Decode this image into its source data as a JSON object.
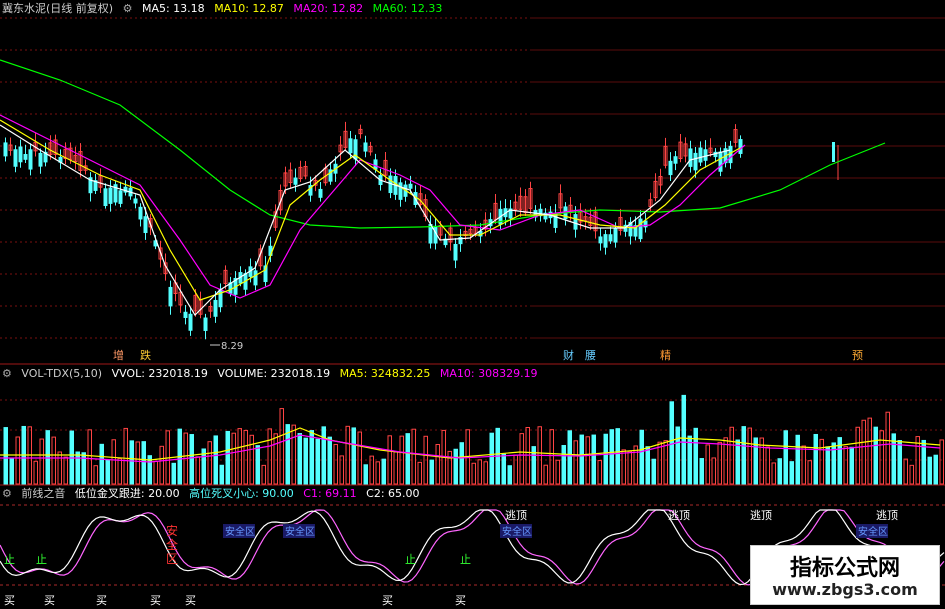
{
  "header": {
    "title": "冀东水泥(日线 前复权)",
    "ma5": "MA5: 13.18",
    "ma10": "MA10: 12.87",
    "ma20": "MA20: 12.82",
    "ma60": "MA60: 12.33"
  },
  "price_panel": {
    "low_label": "8.29",
    "events": [
      {
        "text": "增",
        "color": "#ff9966"
      },
      {
        "text": "跌",
        "color": "#ffcc33"
      },
      {
        "text": "财",
        "color": "#66ccff"
      },
      {
        "text": "腰",
        "color": "#66ccff"
      },
      {
        "text": "精",
        "color": "#ff9933"
      },
      {
        "text": "预",
        "color": "#ffaa33"
      }
    ]
  },
  "volume_panel": {
    "title": "VOL-TDX(5,10)",
    "vvol": "VVOL: 232018.19",
    "volume": "VOLUME: 232018.19",
    "ma5": "MA5: 324832.25",
    "ma10": "MA10: 308329.19"
  },
  "indicator_panel": {
    "title": "前线之音",
    "p1": "低位金叉跟进: 20.00",
    "p2": "高位死叉小心: 90.00",
    "c1": "C1: 69.11",
    "c2": "C2: 65.00",
    "buy_label": "买",
    "sell_label": "逃顶",
    "safe_label": "安全区",
    "vert_label": "安全区",
    "small_label": "止"
  },
  "watermark": {
    "line1": "指标公式网",
    "line2": "www.zbgs3.com"
  },
  "colors": {
    "up": "#ff4444",
    "down": "#54ffff",
    "ma5": "#ffffff",
    "ma10": "#ffff00",
    "ma20": "#ff00ff",
    "ma60": "#00ff00"
  }
}
